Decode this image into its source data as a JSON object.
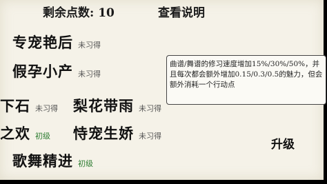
{
  "hud": {
    "remaining_points": "剩余点数: 10",
    "view_explanation": "查看说明"
  },
  "skills": [
    {
      "name": "专宠艳后",
      "status": "未习得"
    },
    {
      "name": "假孕小产",
      "status": "未习得"
    },
    {
      "name": "下石",
      "status": "未习得"
    },
    {
      "name": "梨花带雨",
      "status": "未习得"
    },
    {
      "name": "之欢",
      "status": "初级"
    },
    {
      "name": "恃宠生娇",
      "status": "未习得"
    },
    {
      "name": "歌舞精进",
      "status": "初级"
    }
  ],
  "description": "曲谱/舞谱的修习速度增加15%/30%/50%，并且每次都会额外增加0.15/0.3/0.5的魅力，但会额外消耗一个行动点",
  "upgrade_label": "升级",
  "colors": {
    "background": "#f5f2e8",
    "status_unlearned": "#555555",
    "status_basic": "#2e7d32"
  }
}
